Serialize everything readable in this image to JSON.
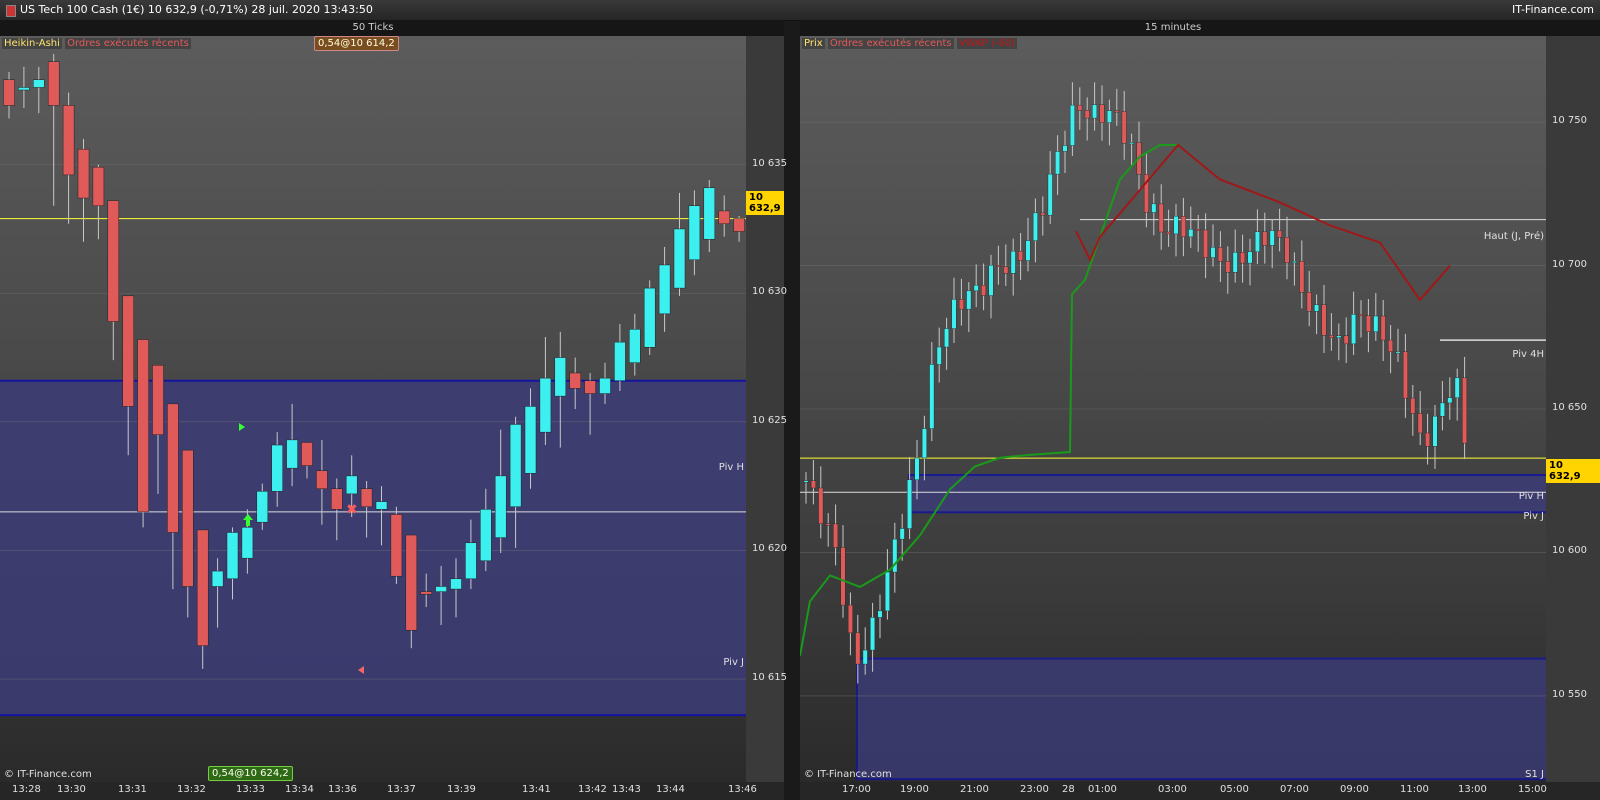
{
  "window": {
    "title": "US Tech 100 Cash (1€)   10 632,9 (-0,71%)   28 juil. 2020 13:43:50",
    "brand": "IT-Finance.com"
  },
  "colors": {
    "bull": "#3df0f0",
    "bear": "#e05a5a",
    "current_price_line": "#ffff33",
    "zone_fill": "#3c3c78",
    "zone_border": "#1414a0",
    "vwap_green": "#1a9a1a",
    "vwap_red": "#a01818",
    "pivot_line": "#dddddd"
  },
  "left_panel": {
    "title": "50 Ticks",
    "indicator_label": "Heikin-Ashi",
    "orders_label": "Ordres exécutés récents",
    "order_tag_top": "0,54@10 614,2",
    "order_tag_bottom": "0,54@10 624,2",
    "footer_brand": "© IT-Finance.com",
    "current_price": "10 632,9",
    "pivot_labels": {
      "piv_h": "Piv H",
      "piv_j": "Piv J"
    },
    "y_ticks": [
      "10 635",
      "10 630",
      "10 625",
      "10 620",
      "10 615"
    ],
    "x_ticks": [
      "13:28",
      "13:30",
      "13:31",
      "13:32",
      "13:33",
      "13:34",
      "13:36",
      "13:37",
      "13:39",
      "13:41",
      "13:42",
      "13:43",
      "13:44",
      "13:46"
    ]
  },
  "right_panel": {
    "title": "15 minutes",
    "indicator_label": "Prix",
    "orders_label": "Ordres exécutés récents",
    "vwap_label": "VWAP (-60)",
    "footer_brand": "© IT-Finance.com",
    "current_price": "10 632,9",
    "level_labels": {
      "haut": "Haut (J, Pré)",
      "piv_4h": "Piv 4H",
      "piv_h": "Piv H",
      "piv_j": "Piv J",
      "s1_j": "S1 J"
    },
    "y_ticks": [
      "10 750",
      "10 700",
      "10 650",
      "10 600",
      "10 550"
    ],
    "x_ticks": [
      "17:00",
      "19:00",
      "21:00",
      "23:00",
      "28",
      "01:00",
      "03:00",
      "05:00",
      "07:00",
      "09:00",
      "11:00",
      "13:00",
      "15:00"
    ]
  },
  "chart_data": [
    {
      "type": "candlestick",
      "title": "50 Ticks",
      "series_name": "Heikin-Ashi",
      "ylim": [
        10611,
        10640
      ],
      "current_price": 10632.9,
      "levels": {
        "piv_h": 10621.5,
        "piv_j": 10613.6,
        "zone_top": 10626.6
      },
      "candles": [
        [
          10638.3,
          10637.3,
          10638.6,
          10636.8
        ],
        [
          10637.9,
          10638.0,
          10638.8,
          10637.2
        ],
        [
          10638.0,
          10638.3,
          10638.8,
          10637.0
        ],
        [
          10639.0,
          10637.3,
          10639.3,
          10633.4
        ],
        [
          10637.3,
          10634.6,
          10637.8,
          10632.7
        ],
        [
          10635.6,
          10633.7,
          10636.0,
          10632.0
        ],
        [
          10634.9,
          10633.4,
          10635.0,
          10632.1
        ],
        [
          10633.6,
          10628.9,
          10633.6,
          10627.4
        ],
        [
          10629.9,
          10625.6,
          10629.9,
          10623.7
        ],
        [
          10628.2,
          10621.5,
          10628.2,
          10620.9
        ],
        [
          10627.2,
          10624.5,
          10627.2,
          10622.2
        ],
        [
          10625.7,
          10620.7,
          10625.7,
          10618.5
        ],
        [
          10623.9,
          10618.6,
          10623.9,
          10617.4
        ],
        [
          10620.8,
          10616.3,
          10620.8,
          10615.4
        ],
        [
          10618.6,
          10619.2,
          10619.7,
          10617.0
        ],
        [
          10618.9,
          10620.7,
          10620.9,
          10618.1
        ],
        [
          10619.7,
          10620.9,
          10621.6,
          10619.1
        ],
        [
          10621.1,
          10622.3,
          10622.6,
          10620.8
        ],
        [
          10622.3,
          10624.1,
          10624.6,
          10621.7
        ],
        [
          10623.2,
          10624.3,
          10625.7,
          10622.5
        ],
        [
          10624.2,
          10623.3,
          10624.2,
          10622.8
        ],
        [
          10623.1,
          10622.4,
          10624.3,
          10621.0
        ],
        [
          10622.4,
          10621.6,
          10622.8,
          10620.4
        ],
        [
          10622.2,
          10622.9,
          10623.7,
          10621.3
        ],
        [
          10622.4,
          10621.7,
          10622.7,
          10620.5
        ],
        [
          10621.6,
          10621.9,
          10622.5,
          10620.2
        ],
        [
          10621.4,
          10619.0,
          10621.7,
          10618.7
        ],
        [
          10620.6,
          10616.9,
          10620.6,
          10616.2
        ],
        [
          10618.4,
          10618.3,
          10619.1,
          10617.8
        ],
        [
          10618.4,
          10618.6,
          10619.4,
          10617.1
        ],
        [
          10618.5,
          10618.9,
          10619.7,
          10617.4
        ],
        [
          10618.9,
          10620.3,
          10621.2,
          10618.5
        ],
        [
          10619.6,
          10621.6,
          10622.4,
          10619.2
        ],
        [
          10620.5,
          10622.9,
          10624.7,
          10619.9
        ],
        [
          10621.7,
          10624.9,
          10625.2,
          10620.1
        ],
        [
          10623.0,
          10625.6,
          10626.3,
          10622.4
        ],
        [
          10624.6,
          10626.7,
          10628.3,
          10624.1
        ],
        [
          10626.0,
          10627.5,
          10628.5,
          10624.0
        ],
        [
          10626.9,
          10626.3,
          10627.5,
          10625.5
        ],
        [
          10626.6,
          10626.1,
          10626.9,
          10624.5
        ],
        [
          10626.1,
          10626.7,
          10627.3,
          10625.7
        ],
        [
          10626.6,
          10628.1,
          10628.8,
          10626.2
        ],
        [
          10627.3,
          10628.6,
          10629.2,
          10626.8
        ],
        [
          10627.9,
          10630.2,
          10630.5,
          10627.6
        ],
        [
          10629.2,
          10631.1,
          10631.8,
          10628.5
        ],
        [
          10630.2,
          10632.5,
          10633.9,
          10629.9
        ],
        [
          10631.3,
          10633.4,
          10634.0,
          10630.7
        ],
        [
          10632.1,
          10634.1,
          10634.4,
          10631.6
        ],
        [
          10633.2,
          10632.7,
          10633.8,
          10632.2
        ],
        [
          10632.9,
          10632.4,
          10633.0,
          10632.0
        ]
      ]
    },
    {
      "type": "candlestick",
      "title": "15 minutes",
      "series_name": "Prix",
      "ylim": [
        10520,
        10780
      ],
      "current_price": 10632.9,
      "levels": {
        "haut_j_pre": 10716,
        "piv_4h": 10674,
        "piv_h": 10621,
        "piv_j": 10614,
        "s1_j": 10520
      }
    }
  ]
}
